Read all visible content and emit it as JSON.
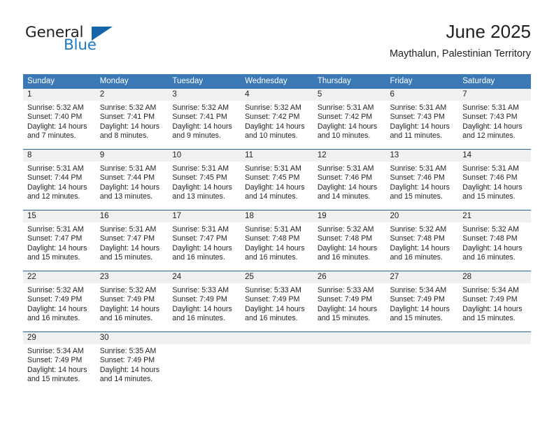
{
  "brand": {
    "name_part1": "General",
    "name_part2": "Blue",
    "triangle_color": "#1565a8",
    "blue_text_color": "#1f7ac4"
  },
  "header": {
    "title": "June 2025",
    "subtitle": "Maythalun, Palestinian Territory"
  },
  "theme": {
    "header_row_bg": "#3b78b6",
    "daynum_band_bg": "#f0f0f0",
    "row_rule_color": "#2b6196",
    "text_color": "#231f20"
  },
  "weekday_headers": [
    "Sunday",
    "Monday",
    "Tuesday",
    "Wednesday",
    "Thursday",
    "Friday",
    "Saturday"
  ],
  "weeks": [
    [
      {
        "day": "1",
        "sunrise": "Sunrise: 5:32 AM",
        "sunset": "Sunset: 7:40 PM",
        "daylight_line1": "Daylight: 14 hours",
        "daylight_line2": "and 7 minutes."
      },
      {
        "day": "2",
        "sunrise": "Sunrise: 5:32 AM",
        "sunset": "Sunset: 7:41 PM",
        "daylight_line1": "Daylight: 14 hours",
        "daylight_line2": "and 8 minutes."
      },
      {
        "day": "3",
        "sunrise": "Sunrise: 5:32 AM",
        "sunset": "Sunset: 7:41 PM",
        "daylight_line1": "Daylight: 14 hours",
        "daylight_line2": "and 9 minutes."
      },
      {
        "day": "4",
        "sunrise": "Sunrise: 5:32 AM",
        "sunset": "Sunset: 7:42 PM",
        "daylight_line1": "Daylight: 14 hours",
        "daylight_line2": "and 10 minutes."
      },
      {
        "day": "5",
        "sunrise": "Sunrise: 5:31 AM",
        "sunset": "Sunset: 7:42 PM",
        "daylight_line1": "Daylight: 14 hours",
        "daylight_line2": "and 10 minutes."
      },
      {
        "day": "6",
        "sunrise": "Sunrise: 5:31 AM",
        "sunset": "Sunset: 7:43 PM",
        "daylight_line1": "Daylight: 14 hours",
        "daylight_line2": "and 11 minutes."
      },
      {
        "day": "7",
        "sunrise": "Sunrise: 5:31 AM",
        "sunset": "Sunset: 7:43 PM",
        "daylight_line1": "Daylight: 14 hours",
        "daylight_line2": "and 12 minutes."
      }
    ],
    [
      {
        "day": "8",
        "sunrise": "Sunrise: 5:31 AM",
        "sunset": "Sunset: 7:44 PM",
        "daylight_line1": "Daylight: 14 hours",
        "daylight_line2": "and 12 minutes."
      },
      {
        "day": "9",
        "sunrise": "Sunrise: 5:31 AM",
        "sunset": "Sunset: 7:44 PM",
        "daylight_line1": "Daylight: 14 hours",
        "daylight_line2": "and 13 minutes."
      },
      {
        "day": "10",
        "sunrise": "Sunrise: 5:31 AM",
        "sunset": "Sunset: 7:45 PM",
        "daylight_line1": "Daylight: 14 hours",
        "daylight_line2": "and 13 minutes."
      },
      {
        "day": "11",
        "sunrise": "Sunrise: 5:31 AM",
        "sunset": "Sunset: 7:45 PM",
        "daylight_line1": "Daylight: 14 hours",
        "daylight_line2": "and 14 minutes."
      },
      {
        "day": "12",
        "sunrise": "Sunrise: 5:31 AM",
        "sunset": "Sunset: 7:46 PM",
        "daylight_line1": "Daylight: 14 hours",
        "daylight_line2": "and 14 minutes."
      },
      {
        "day": "13",
        "sunrise": "Sunrise: 5:31 AM",
        "sunset": "Sunset: 7:46 PM",
        "daylight_line1": "Daylight: 14 hours",
        "daylight_line2": "and 15 minutes."
      },
      {
        "day": "14",
        "sunrise": "Sunrise: 5:31 AM",
        "sunset": "Sunset: 7:46 PM",
        "daylight_line1": "Daylight: 14 hours",
        "daylight_line2": "and 15 minutes."
      }
    ],
    [
      {
        "day": "15",
        "sunrise": "Sunrise: 5:31 AM",
        "sunset": "Sunset: 7:47 PM",
        "daylight_line1": "Daylight: 14 hours",
        "daylight_line2": "and 15 minutes."
      },
      {
        "day": "16",
        "sunrise": "Sunrise: 5:31 AM",
        "sunset": "Sunset: 7:47 PM",
        "daylight_line1": "Daylight: 14 hours",
        "daylight_line2": "and 15 minutes."
      },
      {
        "day": "17",
        "sunrise": "Sunrise: 5:31 AM",
        "sunset": "Sunset: 7:47 PM",
        "daylight_line1": "Daylight: 14 hours",
        "daylight_line2": "and 16 minutes."
      },
      {
        "day": "18",
        "sunrise": "Sunrise: 5:31 AM",
        "sunset": "Sunset: 7:48 PM",
        "daylight_line1": "Daylight: 14 hours",
        "daylight_line2": "and 16 minutes."
      },
      {
        "day": "19",
        "sunrise": "Sunrise: 5:32 AM",
        "sunset": "Sunset: 7:48 PM",
        "daylight_line1": "Daylight: 14 hours",
        "daylight_line2": "and 16 minutes."
      },
      {
        "day": "20",
        "sunrise": "Sunrise: 5:32 AM",
        "sunset": "Sunset: 7:48 PM",
        "daylight_line1": "Daylight: 14 hours",
        "daylight_line2": "and 16 minutes."
      },
      {
        "day": "21",
        "sunrise": "Sunrise: 5:32 AM",
        "sunset": "Sunset: 7:48 PM",
        "daylight_line1": "Daylight: 14 hours",
        "daylight_line2": "and 16 minutes."
      }
    ],
    [
      {
        "day": "22",
        "sunrise": "Sunrise: 5:32 AM",
        "sunset": "Sunset: 7:49 PM",
        "daylight_line1": "Daylight: 14 hours",
        "daylight_line2": "and 16 minutes."
      },
      {
        "day": "23",
        "sunrise": "Sunrise: 5:32 AM",
        "sunset": "Sunset: 7:49 PM",
        "daylight_line1": "Daylight: 14 hours",
        "daylight_line2": "and 16 minutes."
      },
      {
        "day": "24",
        "sunrise": "Sunrise: 5:33 AM",
        "sunset": "Sunset: 7:49 PM",
        "daylight_line1": "Daylight: 14 hours",
        "daylight_line2": "and 16 minutes."
      },
      {
        "day": "25",
        "sunrise": "Sunrise: 5:33 AM",
        "sunset": "Sunset: 7:49 PM",
        "daylight_line1": "Daylight: 14 hours",
        "daylight_line2": "and 16 minutes."
      },
      {
        "day": "26",
        "sunrise": "Sunrise: 5:33 AM",
        "sunset": "Sunset: 7:49 PM",
        "daylight_line1": "Daylight: 14 hours",
        "daylight_line2": "and 15 minutes."
      },
      {
        "day": "27",
        "sunrise": "Sunrise: 5:34 AM",
        "sunset": "Sunset: 7:49 PM",
        "daylight_line1": "Daylight: 14 hours",
        "daylight_line2": "and 15 minutes."
      },
      {
        "day": "28",
        "sunrise": "Sunrise: 5:34 AM",
        "sunset": "Sunset: 7:49 PM",
        "daylight_line1": "Daylight: 14 hours",
        "daylight_line2": "and 15 minutes."
      }
    ],
    [
      {
        "day": "29",
        "sunrise": "Sunrise: 5:34 AM",
        "sunset": "Sunset: 7:49 PM",
        "daylight_line1": "Daylight: 14 hours",
        "daylight_line2": "and 15 minutes."
      },
      {
        "day": "30",
        "sunrise": "Sunrise: 5:35 AM",
        "sunset": "Sunset: 7:49 PM",
        "daylight_line1": "Daylight: 14 hours",
        "daylight_line2": "and 14 minutes."
      },
      {
        "day": "",
        "sunrise": "",
        "sunset": "",
        "daylight_line1": "",
        "daylight_line2": ""
      },
      {
        "day": "",
        "sunrise": "",
        "sunset": "",
        "daylight_line1": "",
        "daylight_line2": ""
      },
      {
        "day": "",
        "sunrise": "",
        "sunset": "",
        "daylight_line1": "",
        "daylight_line2": ""
      },
      {
        "day": "",
        "sunrise": "",
        "sunset": "",
        "daylight_line1": "",
        "daylight_line2": ""
      },
      {
        "day": "",
        "sunrise": "",
        "sunset": "",
        "daylight_line1": "",
        "daylight_line2": ""
      }
    ]
  ]
}
